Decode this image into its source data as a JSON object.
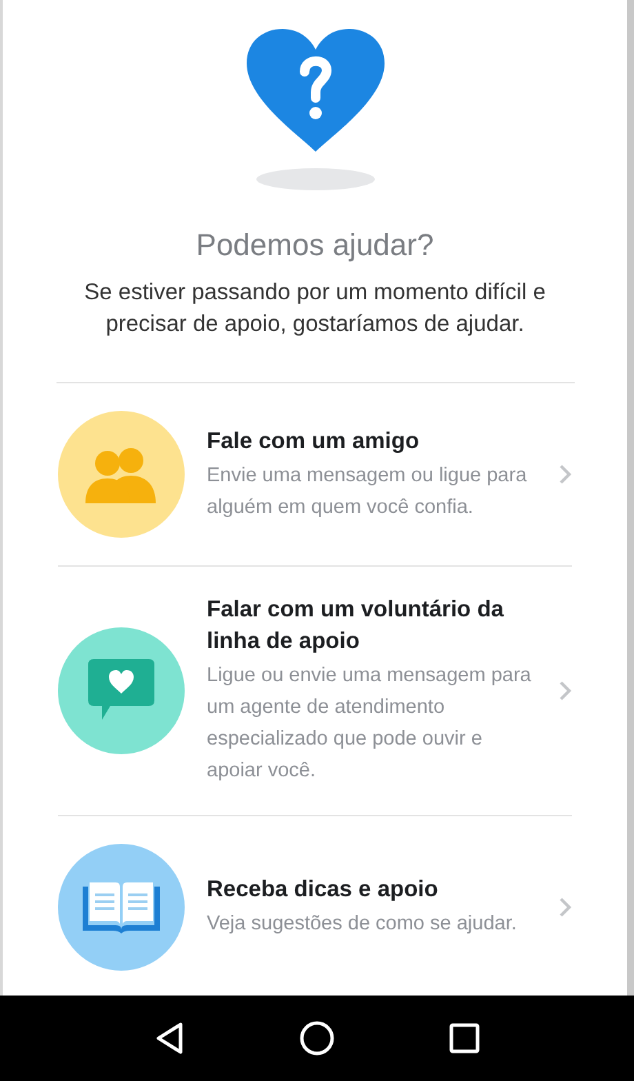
{
  "header": {
    "title": "Podemos ajudar?",
    "message": "Se estiver passando por um momento difícil e precisar de apoio, gostaríamos de ajudar."
  },
  "options": [
    {
      "kind": "friend",
      "title": "Fale com um amigo",
      "description": "Envie uma mensagem ou ligue para alguém em quem você confia."
    },
    {
      "kind": "helpline",
      "title": "Falar com um voluntário da linha de apoio",
      "description": "Ligue ou envie uma mensagem para um agente de atendimento especializado que pode ouvir e apoiar você."
    },
    {
      "kind": "tips",
      "title": "Receba dicas e apoio",
      "description": "Veja sugestões de como se ajudar."
    }
  ]
}
